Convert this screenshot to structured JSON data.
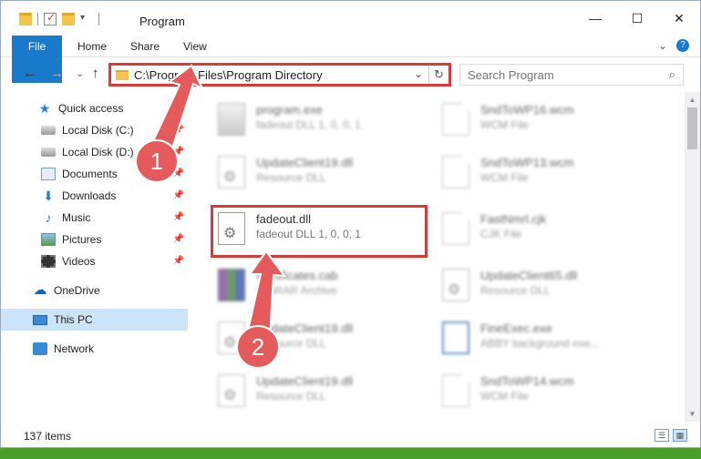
{
  "titlebar": {
    "title": "Program",
    "minimize": "—",
    "maximize": "☐",
    "close": "✕"
  },
  "ribbon": {
    "tabs": [
      "File",
      "Home",
      "Share",
      "View"
    ],
    "expand": "⌄",
    "help": "?"
  },
  "nav": {
    "back": "←",
    "forward": "→",
    "recent": "⌄",
    "up": "↑"
  },
  "address": {
    "path": "C:\\Program Files\\Program Directory",
    "dropdown": "⌄",
    "refresh": "↻"
  },
  "search": {
    "placeholder": "Search Program",
    "icon": "⌕"
  },
  "sidebar": {
    "items": [
      {
        "label": "Quick access",
        "icon": "star-icon",
        "pinned": false
      },
      {
        "label": "Local Disk (C:)",
        "icon": "disk-icon",
        "pinned": true
      },
      {
        "label": "Local Disk (D:)",
        "icon": "disk-icon",
        "pinned": true
      },
      {
        "label": "Documents",
        "icon": "documents-icon",
        "pinned": true
      },
      {
        "label": "Downloads",
        "icon": "download-icon",
        "pinned": true
      },
      {
        "label": "Music",
        "icon": "music-icon",
        "pinned": true
      },
      {
        "label": "Pictures",
        "icon": "pictures-icon",
        "pinned": true
      },
      {
        "label": "Videos",
        "icon": "videos-icon",
        "pinned": true
      },
      {
        "label": "OneDrive",
        "icon": "onedrive-icon",
        "pinned": false
      },
      {
        "label": "This PC",
        "icon": "pc-icon",
        "pinned": false,
        "selected": true
      },
      {
        "label": "Network",
        "icon": "network-icon",
        "pinned": false
      }
    ],
    "pin_glyph": "📌"
  },
  "files": {
    "left": [
      {
        "name": "program.exe",
        "desc": "fadeout DLL 1, 0, 0, 1",
        "icon": "exe-icon"
      },
      {
        "name": "UpdateClient19.dll",
        "desc": "Resource DLL",
        "icon": "gear-file-icon"
      },
      {
        "name": "fadeout.dll",
        "desc": "fadeout DLL 1, 0, 0, 1",
        "icon": "gear-file-icon"
      },
      {
        "name": "Certificates.cab",
        "desc": "WinRAR Archive",
        "icon": "archive-icon"
      },
      {
        "name": "UpdateClient19.dll",
        "desc": "Resource DLL",
        "icon": "gear-file-icon"
      },
      {
        "name": "UpdateClient19.dll",
        "desc": "Resource DLL",
        "icon": "gear-file-icon"
      }
    ],
    "right": [
      {
        "name": "SndToWP16.wcm",
        "desc": "WCM File",
        "icon": "file-icon"
      },
      {
        "name": "SndToWP13.wcm",
        "desc": "WCM File",
        "icon": "file-icon"
      },
      {
        "name": "FastNmrl.cjk",
        "desc": "CJK File",
        "icon": "file-icon"
      },
      {
        "name": "UpdateClient65.dll",
        "desc": "Resource DLL",
        "icon": "gear-file-icon"
      },
      {
        "name": "FineExec.exe",
        "desc": "ABBY background exe...",
        "icon": "app-icon"
      },
      {
        "name": "SndToWP14.wcm",
        "desc": "WCM File",
        "icon": "file-icon"
      }
    ]
  },
  "annotations": {
    "step1": "1",
    "step2": "2"
  },
  "status": {
    "count": "137 items"
  },
  "colors": {
    "accent": "#1979ca",
    "annotation": "#d93a3a",
    "selected": "#cce4f7"
  }
}
